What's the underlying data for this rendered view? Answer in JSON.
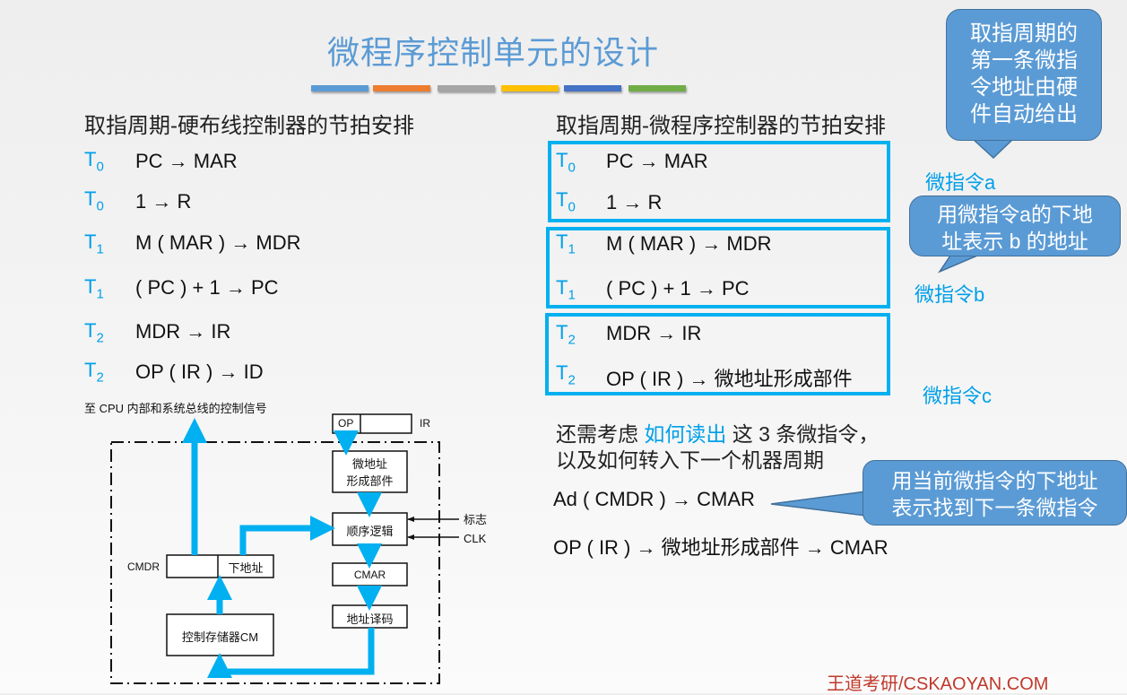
{
  "title": "微程序控制单元的设计",
  "color_bars": [
    "#5b9bd5",
    "#ed7d31",
    "#a5a5a5",
    "#ffc000",
    "#4472c4",
    "#70ad47"
  ],
  "left": {
    "heading": "取指周期-硬布线控制器的节拍安排",
    "rows": [
      {
        "t": "T",
        "sub": "0",
        "op": "PC → MAR"
      },
      {
        "t": "T",
        "sub": "0",
        "op": "1 → R"
      },
      {
        "t": "T",
        "sub": "1",
        "op": "M ( MAR ) → MDR"
      },
      {
        "t": "T",
        "sub": "1",
        "op": "( PC ) + 1 → PC"
      },
      {
        "t": "T",
        "sub": "2",
        "op": "MDR → IR"
      },
      {
        "t": "T",
        "sub": "2",
        "op": "OP ( IR ) → ID"
      }
    ]
  },
  "diagram": {
    "caption": "至 CPU 内部和系统总线的控制信号",
    "ir_op": "OP",
    "ir_label": "IR",
    "micro_addr_line1": "微地址",
    "micro_addr_line2": "形成部件",
    "seq_logic": "顺序逻辑",
    "flag_label": "标志",
    "clk_label": "CLK",
    "cmar": "CMAR",
    "addr_decode": "地址译码",
    "cmdr_label": "CMDR",
    "next_addr": "下地址",
    "control_store": "控制存储器CM"
  },
  "right": {
    "heading": "取指周期-微程序控制器的节拍安排",
    "groups": [
      {
        "label": "微指令a",
        "rows": [
          {
            "t": "T",
            "sub": "0",
            "op": "PC → MAR"
          },
          {
            "t": "T",
            "sub": "0",
            "op": "1 → R"
          }
        ]
      },
      {
        "label": "微指令b",
        "rows": [
          {
            "t": "T",
            "sub": "1",
            "op": "M ( MAR ) → MDR"
          },
          {
            "t": "T",
            "sub": "1",
            "op": "( PC ) + 1 → PC"
          }
        ]
      },
      {
        "label": "微指令c",
        "rows": [
          {
            "t": "T",
            "sub": "2",
            "op": "MDR → IR"
          },
          {
            "t": "T",
            "sub": "2",
            "op": "OP ( IR ) → 微地址形成部件"
          }
        ]
      }
    ],
    "note_prefix": "还需考虑 ",
    "note_highlight": "如何读出",
    "note_suffix": " 这 3 条微指令，",
    "note_line2": "以及如何转入下一个机器周期",
    "formula1": "Ad ( CMDR ) → CMAR",
    "formula2": "OP ( IR ) → 微地址形成部件 → CMAR"
  },
  "callouts": {
    "first": [
      "取指周期的",
      "第一条微指",
      "令地址由硬",
      "件自动给出"
    ],
    "second": [
      "用微指令a的下地",
      "址表示 b 的地址"
    ],
    "third": [
      "用当前微指令的下地址",
      "表示找到下一条微指令"
    ]
  },
  "footer": "王道考研/CSKAOYAN.COM"
}
